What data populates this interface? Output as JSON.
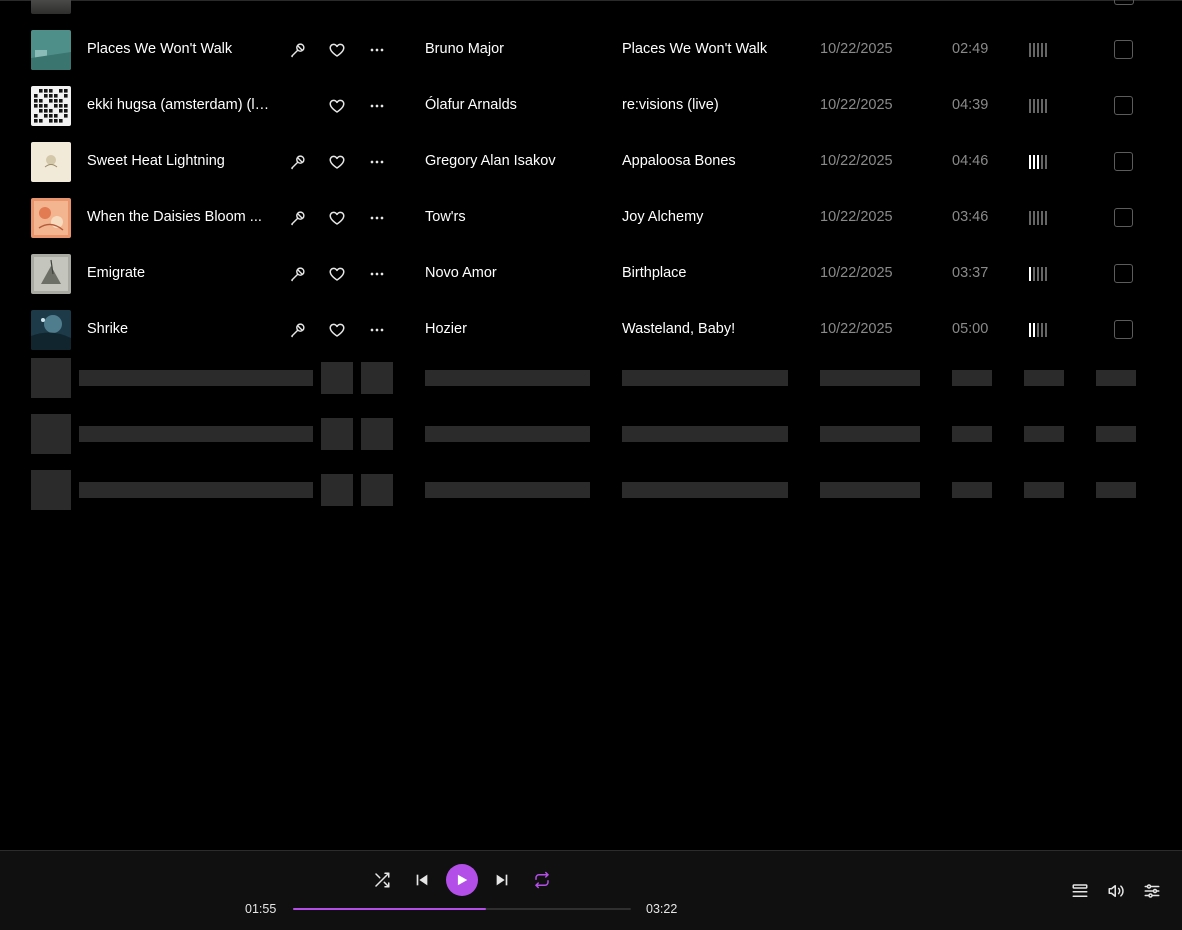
{
  "tracks": [
    {
      "title": "Places We Won't Walk",
      "artist": "Bruno Major",
      "album": "Places We Won't Walk",
      "date_added": "10/22/2025",
      "duration": "02:49",
      "has_lyrics": true,
      "popularity": 0.0,
      "cover": "teal"
    },
    {
      "title": "ekki hugsa (amsterdam) (live)",
      "artist": "Ólafur Arnalds",
      "album": "re:visions (live)",
      "date_added": "10/22/2025",
      "duration": "04:39",
      "has_lyrics": false,
      "popularity": 0.0,
      "cover": "dots"
    },
    {
      "title": "Sweet Heat Lightning",
      "artist": "Gregory Alan Isakov",
      "album": "Appaloosa Bones",
      "date_added": "10/22/2025",
      "duration": "04:46",
      "has_lyrics": true,
      "popularity": 0.6,
      "cover": "cream"
    },
    {
      "title": "When the Daisies Bloom ...",
      "artist": "Tow'rs",
      "album": "Joy Alchemy",
      "date_added": "10/22/2025",
      "duration": "03:46",
      "has_lyrics": true,
      "popularity": 0.0,
      "cover": "salmon"
    },
    {
      "title": "Emigrate",
      "artist": "Novo Amor",
      "album": "Birthplace",
      "date_added": "10/22/2025",
      "duration": "03:37",
      "has_lyrics": true,
      "popularity": 0.2,
      "cover": "grey"
    },
    {
      "title": "Shrike",
      "artist": "Hozier",
      "album": "Wasteland, Baby!",
      "date_added": "10/22/2025",
      "duration": "05:00",
      "has_lyrics": true,
      "popularity": 0.4,
      "cover": "ocean"
    }
  ],
  "loading_placeholder_rows": 3,
  "player": {
    "elapsed": "01:55",
    "total": "03:22",
    "progress": 0.57,
    "shuffle_icon": "shuffle-icon",
    "prev_icon": "skip-previous-icon",
    "play_icon": "play-icon",
    "next_icon": "skip-next-icon",
    "repeat_icon": "repeat-icon",
    "queue_icon": "queue-list-icon",
    "volume_icon": "volume-icon",
    "settings_icon": "sliders-icon"
  },
  "colors": {
    "accent": "#b34fe8",
    "background": "#000000",
    "player_bar": "#101010",
    "muted_text": "#8a8a8a",
    "skeleton": "#2b2b2b"
  }
}
